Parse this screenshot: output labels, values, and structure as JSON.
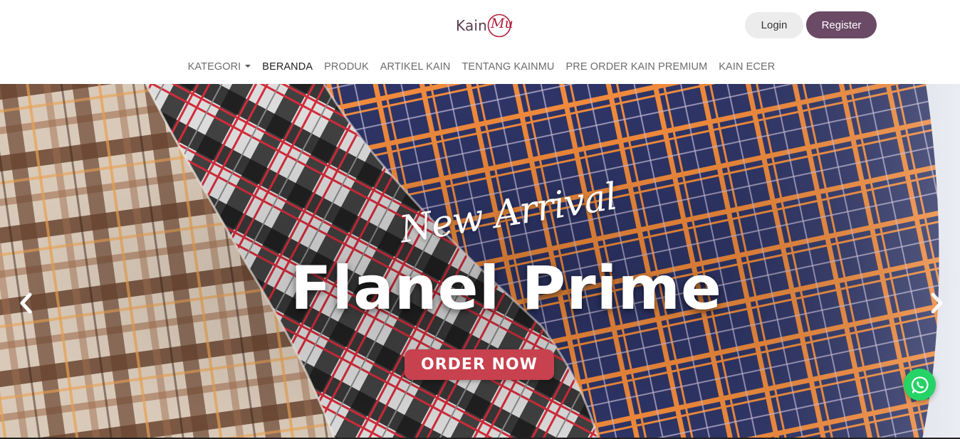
{
  "brand": {
    "logo_text": "Kain",
    "logo_accent": "Mu",
    "primary_color": "#6b4a66",
    "accent_color": "#b01f3b"
  },
  "auth": {
    "login_label": "Login",
    "register_label": "Register"
  },
  "nav": {
    "items": [
      {
        "label": "KATEGORI",
        "has_dropdown": true
      },
      {
        "label": "BERANDA",
        "active": true
      },
      {
        "label": "PRODUK"
      },
      {
        "label": "ARTIKEL KAIN"
      },
      {
        "label": "TENTANG KAINMU"
      },
      {
        "label": "PRE ORDER KAIN PREMIUM"
      },
      {
        "label": "KAIN ECER"
      }
    ]
  },
  "hero": {
    "script_text": "New Arrival",
    "headline": "Flanel Prime",
    "cta_label": "ORDER NOW",
    "cta_color": "#c7414e",
    "prev_icon": "chevron-left-icon",
    "next_icon": "chevron-right-icon"
  },
  "whatsapp": {
    "icon": "whatsapp-icon",
    "color": "#25d366"
  }
}
